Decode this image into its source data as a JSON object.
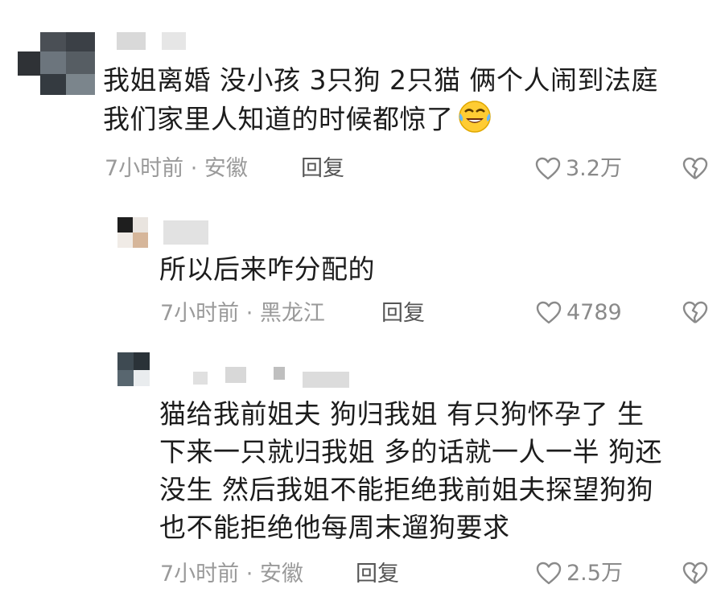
{
  "comments": [
    {
      "text_lines": [
        "我姐离婚 没小孩 3只狗 2只猫 俩个人闹到法庭",
        "我们家里人知道的时候都惊了"
      ],
      "emoji": "laughing-crying-emoji",
      "time_location": "7小时前 · 安徽",
      "reply_label": "回复",
      "likes": "3.2万"
    },
    {
      "text_lines": [
        "所以后来咋分配的"
      ],
      "time_location": "7小时前 · 黑龙江",
      "reply_label": "回复",
      "likes": "4789"
    },
    {
      "text_lines": [
        "猫给我前姐夫 狗归我姐 有只狗怀孕了 生",
        "下来一只就归我姐 多的话就一人一半 狗还",
        "没生 然后我姐不能拒绝我前姐夫探望狗狗",
        "也不能拒绝他每周末遛狗要求"
      ],
      "time_location": "7小时前 · 安徽",
      "reply_label": "回复",
      "likes": "2.5万"
    }
  ],
  "icons": {
    "like": "heart-outline-icon",
    "dislike": "broken-heart-icon"
  },
  "colors": {
    "text": "#1c1c1c",
    "meta": "#9a9a9a",
    "icon": "#8a8a8a"
  }
}
